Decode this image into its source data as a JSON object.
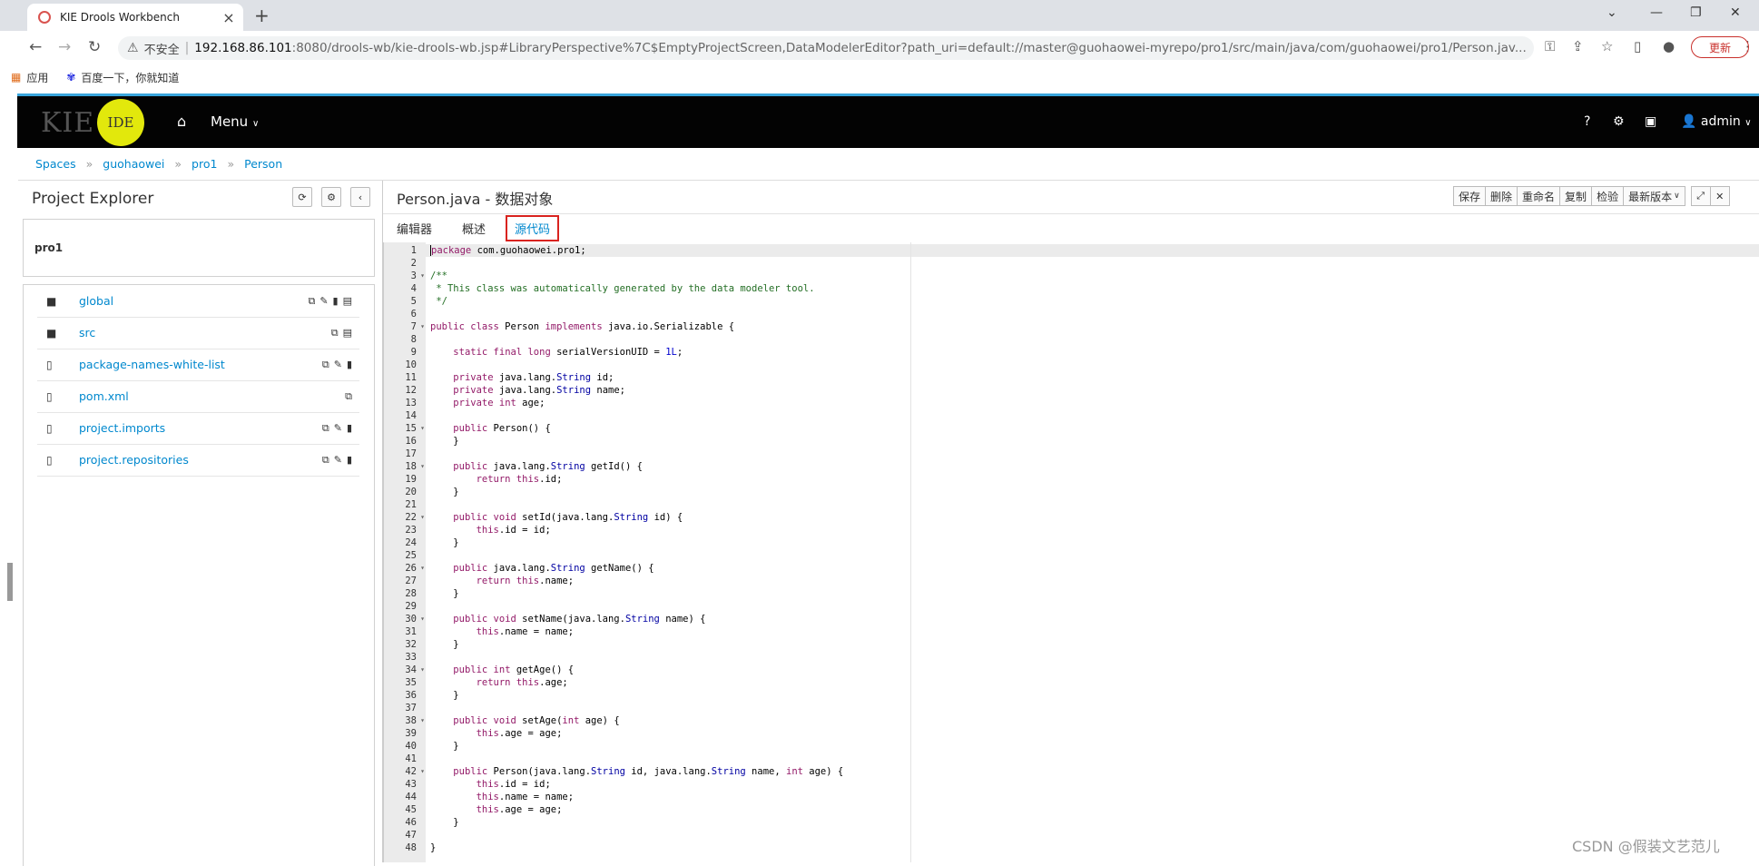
{
  "browser": {
    "tab_title": "KIE Drools Workbench",
    "insecure_label": "不安全",
    "url_host": "192.168.86.101",
    "url_rest": ":8080/drools-wb/kie-drools-wb.jsp#LibraryPerspective%7C$EmptyProjectScreen,DataModelerEditor?path_uri=default://master@guohaowei-myrepo/pro1/src/main/java/com/guohaowei/pro1/Person.jav...",
    "update_label": "更新",
    "bookmarks": [
      {
        "icon": "apps-grid-icon",
        "label": "应用"
      },
      {
        "icon": "baidu-paw-icon",
        "label": "百度一下，你就知道"
      }
    ]
  },
  "app": {
    "logo_text": "KIE",
    "logo_badge": "IDE",
    "menu_label": "Menu",
    "user_label": "admin",
    "accent_color": "#39a5dc",
    "link_color": "#0088ce"
  },
  "breadcrumb": [
    "Spaces",
    "guohaowei",
    "pro1",
    "Person"
  ],
  "explorer": {
    "title": "Project Explorer",
    "project_name": "pro1",
    "files": [
      {
        "name": "global",
        "type": "folder",
        "actions": [
          "copy",
          "rename",
          "delete",
          "archive"
        ]
      },
      {
        "name": "src",
        "type": "folder",
        "actions": [
          "copy",
          "archive"
        ]
      },
      {
        "name": "package-names-white-list",
        "type": "file",
        "actions": [
          "copy",
          "rename",
          "delete"
        ]
      },
      {
        "name": "pom.xml",
        "type": "file",
        "actions": [
          "copy"
        ]
      },
      {
        "name": "project.imports",
        "type": "file",
        "actions": [
          "copy",
          "rename",
          "delete"
        ]
      },
      {
        "name": "project.repositories",
        "type": "file",
        "actions": [
          "copy",
          "rename",
          "delete"
        ]
      }
    ]
  },
  "editor": {
    "title": "Person.java - 数据对象",
    "toolbar": [
      "保存",
      "删除",
      "重命名",
      "复制",
      "检验",
      "最新版本"
    ],
    "tabs": [
      "编辑器",
      "概述",
      "源代码"
    ],
    "active_tab": "源代码"
  },
  "watermark": "CSDN @假装文艺范儿"
}
